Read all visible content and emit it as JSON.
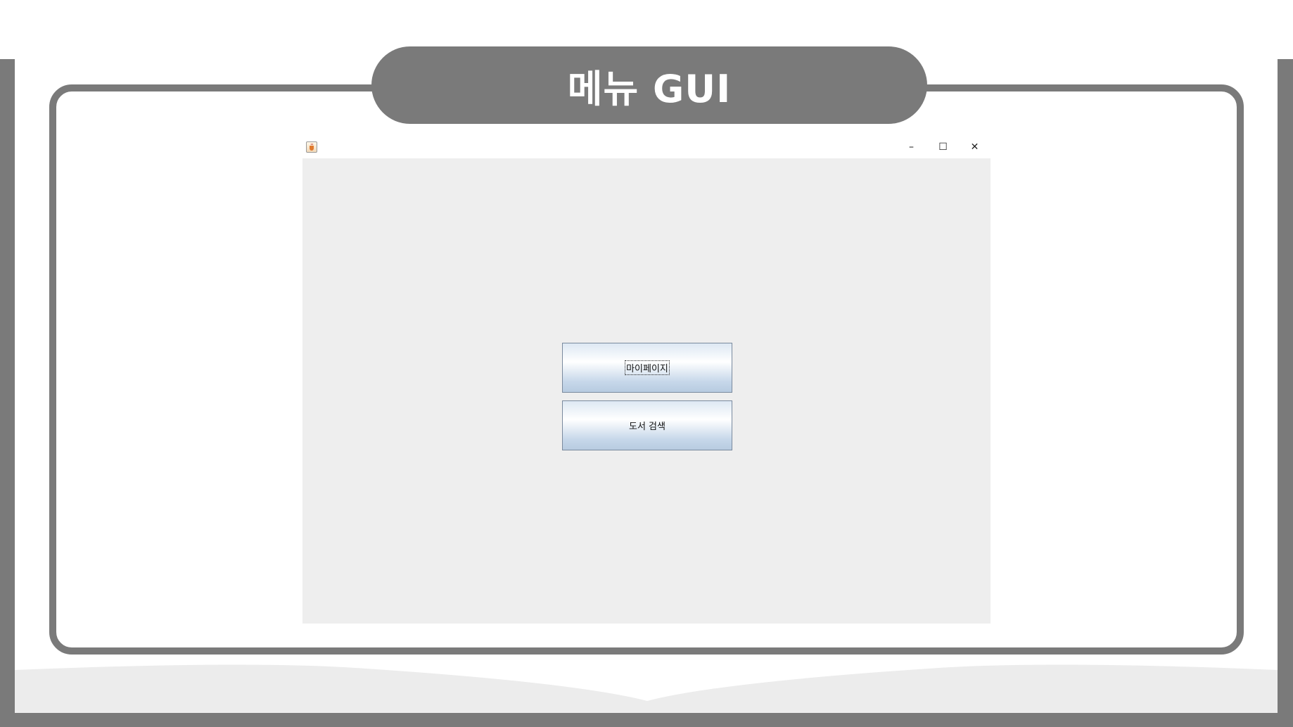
{
  "slide": {
    "title": "메뉴 GUI"
  },
  "window": {
    "icon": "java-coffee-icon",
    "controls": {
      "minimize": "–",
      "maximize": "☐",
      "close": "✕"
    }
  },
  "menu": {
    "buttons": [
      {
        "label": "마이페이지",
        "focused": true
      },
      {
        "label": "도서 검색",
        "focused": false
      }
    ]
  },
  "colors": {
    "frame": "#7a7a7a",
    "window_bg": "#eeeeee",
    "button_gradient_top": "#dde8f3",
    "button_gradient_bottom": "#b8cbe0"
  }
}
